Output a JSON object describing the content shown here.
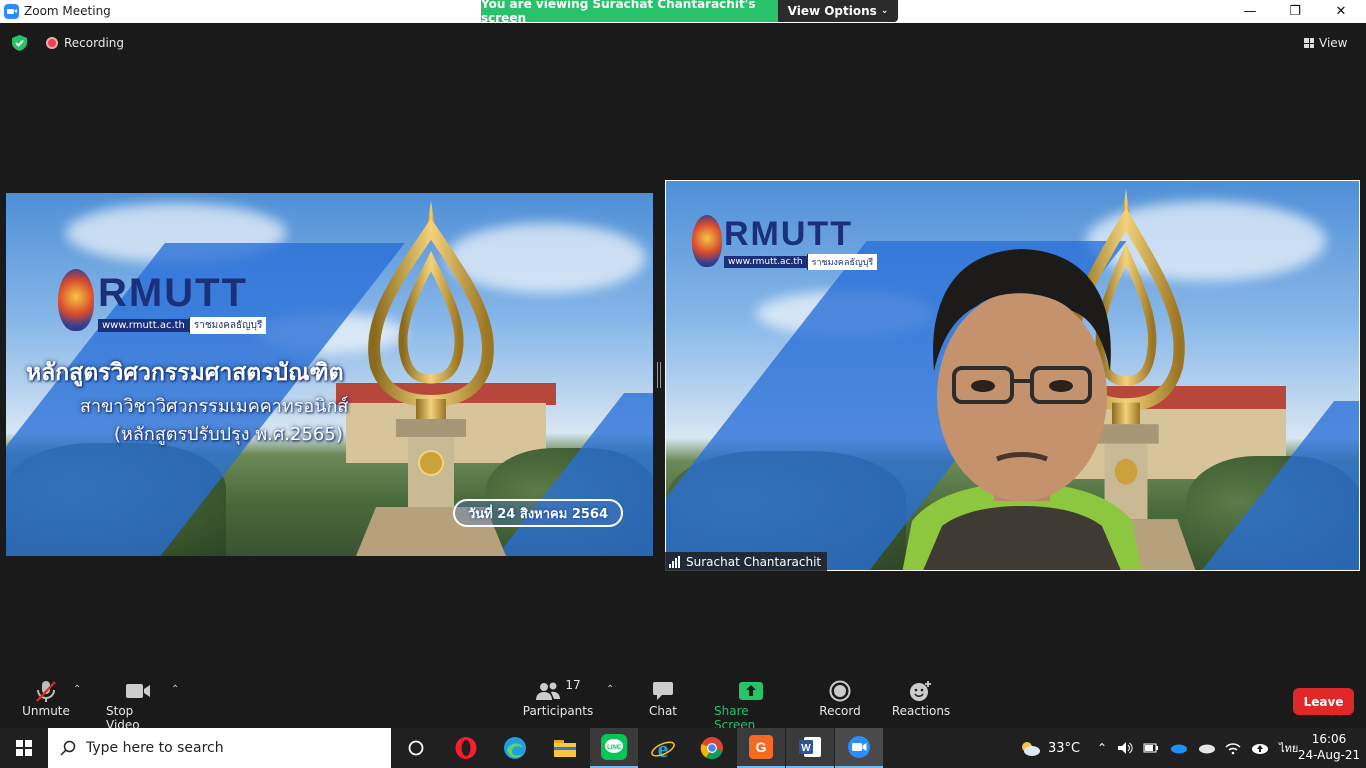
{
  "window": {
    "title": "Zoom Meeting",
    "controls": {
      "minimize": "—",
      "restore": "❐",
      "close": "✕"
    }
  },
  "banner": {
    "viewing_text": "You are viewing Surachat Chantarachit's screen",
    "view_options_label": "View Options"
  },
  "status": {
    "recording_label": "Recording",
    "view_label": "View"
  },
  "slide": {
    "logo_text": "RMUTT",
    "logo_url": "www.rmutt.ac.th",
    "logo_thai": "ราชมงคลธัญบุรี",
    "title_line1": "หลักสูตรวิศวกรรมศาสตรบัณฑิต",
    "title_line2": "สาขาวิชาวิศวกรรมเมคคาทรอนิกส์",
    "title_line3": "(หลักสูตรปรับปรุง พ.ศ.2565)",
    "date": "วันที่ 24 สิงหาคม 2564"
  },
  "camera": {
    "logo_text": "RMUTT",
    "logo_url": "www.rmutt.ac.th",
    "logo_thai": "ราชมงคลธัญบุรี",
    "participant_name": "Surachat Chantarachit"
  },
  "toolbar": {
    "unmute": "Unmute",
    "stop_video": "Stop Video",
    "participants": "Participants",
    "participants_count": "17",
    "chat": "Chat",
    "share_screen": "Share Screen",
    "record": "Record",
    "reactions": "Reactions",
    "leave": "Leave"
  },
  "taskbar": {
    "search_placeholder": "Type here to search",
    "weather_temp": "33°C",
    "language": "ไทย",
    "time": "16:06",
    "date": "24-Aug-21"
  },
  "colors": {
    "banner_green": "#27c26a",
    "share_green": "#27c26a",
    "leave_red": "#e02828",
    "zoom_blue": "#2d8cff"
  }
}
